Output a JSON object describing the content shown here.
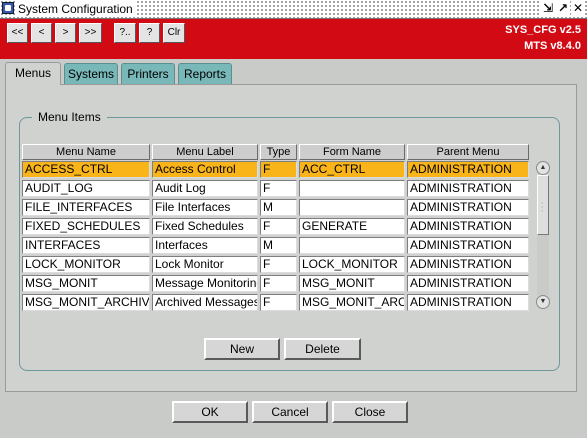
{
  "window": {
    "title": "System Configuration",
    "controls": [
      "⇲",
      "↗",
      "✕"
    ]
  },
  "toolbar": {
    "buttons": [
      {
        "label": "<<",
        "name": "first-record-button"
      },
      {
        "label": "<",
        "name": "previous-record-button"
      },
      {
        "label": ">",
        "name": "next-record-button"
      },
      {
        "label": ">>",
        "name": "last-record-button"
      },
      {
        "label": "?..",
        "name": "list-values-button"
      },
      {
        "label": "?",
        "name": "help-button"
      },
      {
        "label": "Clr",
        "name": "clear-button"
      }
    ],
    "version_line1": "SYS_CFG v2.5",
    "version_line2": "MTS v8.4.0",
    "bg_color": "#d20a14"
  },
  "tabs": [
    {
      "label": "Menus",
      "active": true
    },
    {
      "label": "Systems",
      "active": false
    },
    {
      "label": "Printers",
      "active": false
    },
    {
      "label": "Reports",
      "active": false
    }
  ],
  "group": {
    "legend": "Menu Items"
  },
  "grid": {
    "columns": [
      "Menu Name",
      "Menu Label",
      "Type",
      "Form Name",
      "Parent Menu"
    ],
    "rows": [
      [
        "ACCESS_CTRL",
        "Access Control",
        "F",
        "ACC_CTRL",
        "ADMINISTRATION"
      ],
      [
        "AUDIT_LOG",
        "Audit Log",
        "F",
        "",
        "ADMINISTRATION"
      ],
      [
        "FILE_INTERFACES",
        "File Interfaces",
        "M",
        "",
        "ADMINISTRATION"
      ],
      [
        "FIXED_SCHEDULES",
        "Fixed Schedules",
        "F",
        "GENERATE",
        "ADMINISTRATION"
      ],
      [
        "INTERFACES",
        "Interfaces",
        "M",
        "",
        "ADMINISTRATION"
      ],
      [
        "LOCK_MONITOR",
        "Lock Monitor",
        "F",
        "LOCK_MONITOR",
        "ADMINISTRATION"
      ],
      [
        "MSG_MONIT",
        "Message Monitoring",
        "F",
        "MSG_MONIT",
        "ADMINISTRATION"
      ],
      [
        "MSG_MONIT_ARCHIVE",
        "Archived Messages",
        "F",
        "MSG_MONIT_ARCH",
        "ADMINISTRATION"
      ]
    ],
    "selected_row": 0,
    "selected_color": "#f9b419"
  },
  "buttons": {
    "new": "New",
    "delete": "Delete",
    "ok": "OK",
    "cancel": "Cancel",
    "close": "Close"
  }
}
